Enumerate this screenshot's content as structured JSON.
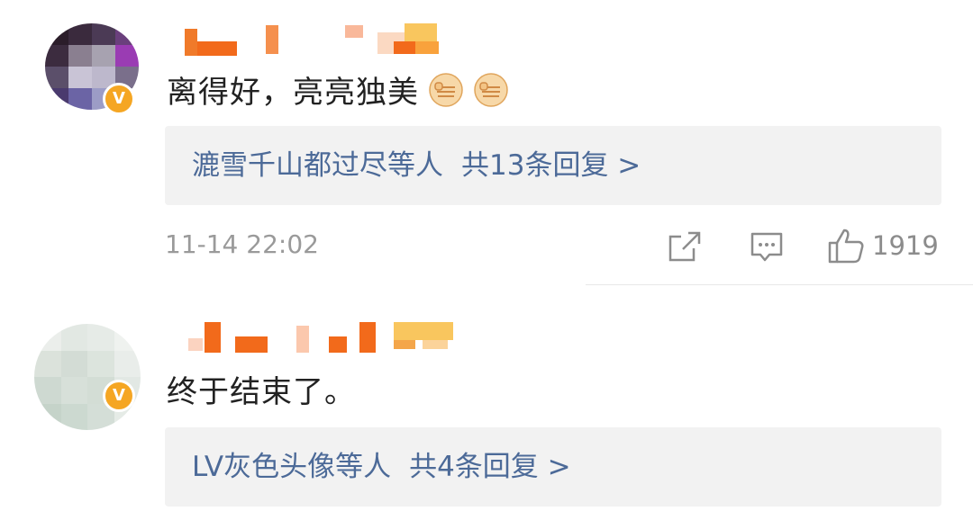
{
  "comments": [
    {
      "text": "离得好，亮亮独美",
      "verified_badge": "V",
      "emoji": [
        "fist-emoji",
        "fist-emoji"
      ],
      "replies": {
        "names": "漉雪千山都过尽等人",
        "count_text": "共13条回复 >"
      },
      "time": "11-14 22:02",
      "likes": "1919",
      "icons": [
        "share-icon",
        "comment-icon",
        "like-icon"
      ]
    },
    {
      "text": "终于结束了。",
      "verified_badge": "V",
      "replies": {
        "names": "LV灰色头像等人",
        "count_text": "共4条回复 >"
      }
    }
  ],
  "colors": {
    "reply_link": "#4c6a98",
    "reply_bg": "#f2f2f2",
    "badge": "#f5a623",
    "meta": "#9a9a9a"
  }
}
